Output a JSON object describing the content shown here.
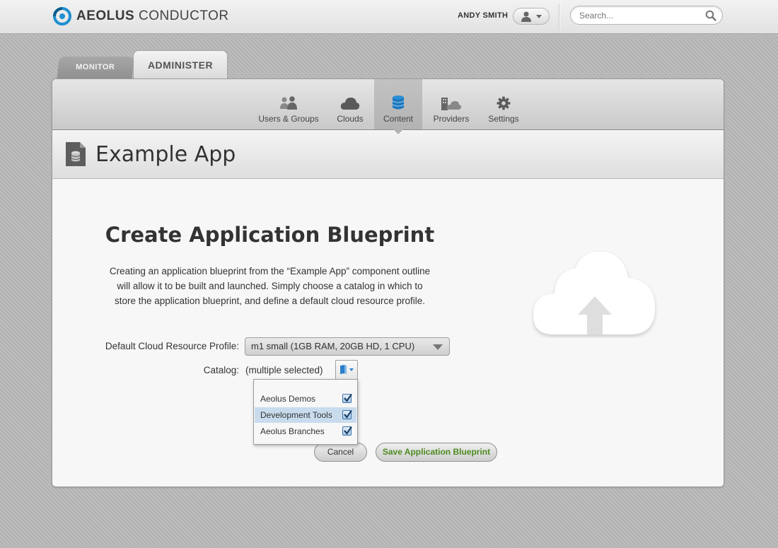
{
  "header": {
    "brand_bold": "AEOLUS",
    "brand_light": " CONDUCTOR",
    "user_name": "ANDY SMITH",
    "search_placeholder": "Search..."
  },
  "tabs": [
    {
      "label": "MONITOR",
      "active": false
    },
    {
      "label": "ADMINISTER",
      "active": true
    }
  ],
  "subnav": [
    {
      "label": "Users & Groups",
      "icon": "users-icon"
    },
    {
      "label": "Clouds",
      "icon": "cloud-icon"
    },
    {
      "label": "Content",
      "icon": "database-icon",
      "active": true
    },
    {
      "label": "Providers",
      "icon": "providers-icon"
    },
    {
      "label": "Settings",
      "icon": "gear-icon"
    }
  ],
  "page": {
    "title": "Example App",
    "icon": "document-icon"
  },
  "form": {
    "title": "Create Application Blueprint",
    "description": "Creating an application blueprint from the “Example App” component outline will allow it to be built and launched. Simply choose a catalog in which to store the application blueprint, and define a default cloud resource profile.",
    "profile_label": "Default Cloud Resource Profile:",
    "profile_value": "m1 small (1GB RAM, 20GB HD, 1 CPU)",
    "catalog_label": "Catalog:",
    "catalog_value": "(multiple selected)",
    "catalog_options": [
      {
        "label": "Aeolus Demos",
        "checked": true,
        "highlighted": false
      },
      {
        "label": "Development Tools",
        "checked": true,
        "highlighted": true
      },
      {
        "label": "Aeolus Branches",
        "checked": true,
        "highlighted": false
      }
    ],
    "cancel_label": "Cancel",
    "save_label": "Save Application Blueprint"
  },
  "colors": {
    "accent_blue": "#2b7fc9",
    "save_green": "#4c8a1e",
    "highlight": "#c9dcee"
  }
}
